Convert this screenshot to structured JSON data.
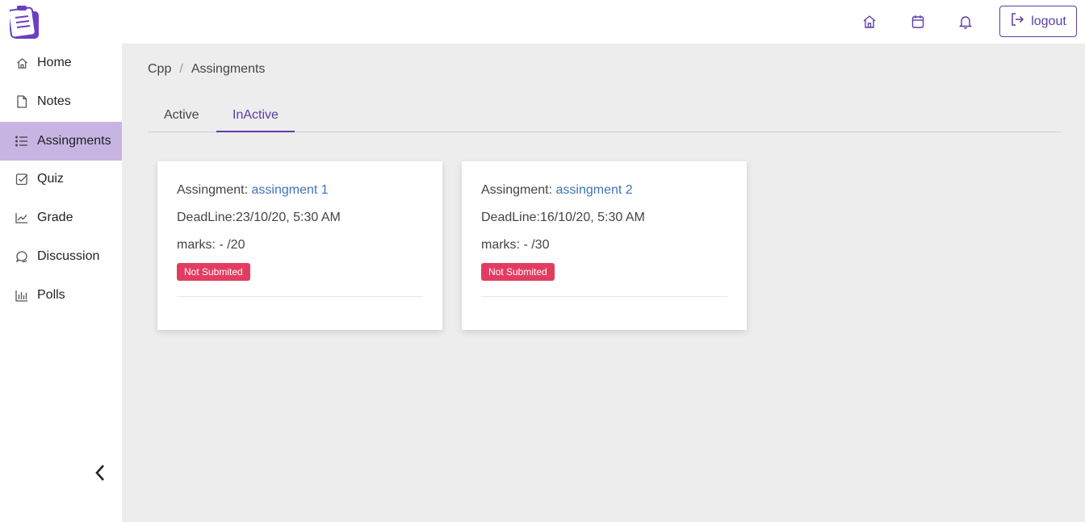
{
  "header": {
    "icons": [
      "home-icon",
      "calendar-icon",
      "bell-icon"
    ],
    "logout_label": "logout"
  },
  "sidebar": {
    "items": [
      {
        "label": "Home",
        "icon": "home-icon"
      },
      {
        "label": "Notes",
        "icon": "file-icon"
      },
      {
        "label": "Assingments",
        "icon": "list-icon",
        "active": true
      },
      {
        "label": "Quiz",
        "icon": "check-square-icon"
      },
      {
        "label": "Grade",
        "icon": "trend-chart-icon"
      },
      {
        "label": "Discussion",
        "icon": "chat-icon"
      },
      {
        "label": "Polls",
        "icon": "bar-chart-icon"
      }
    ]
  },
  "breadcrumb": {
    "course": "Cpp",
    "separator": "/",
    "page": "Assingments"
  },
  "tabs": [
    {
      "label": "Active",
      "active": false
    },
    {
      "label": "InActive",
      "active": true
    }
  ],
  "cards": [
    {
      "assignment_prefix": "Assingment: ",
      "assignment_name": "assingment 1",
      "deadline": "DeadLine:23/10/20, 5:30 AM",
      "marks": "marks: - /20",
      "status": "Not Submited"
    },
    {
      "assignment_prefix": "Assingment: ",
      "assignment_name": "assingment 2",
      "deadline": "DeadLine:16/10/20, 5:30 AM",
      "marks": "marks: - /30",
      "status": "Not Submited"
    }
  ],
  "colors": {
    "accent": "#5b3ea6",
    "sidebar_active": "#c8b4e3",
    "badge": "#e23d61",
    "link": "#3f74b9"
  }
}
